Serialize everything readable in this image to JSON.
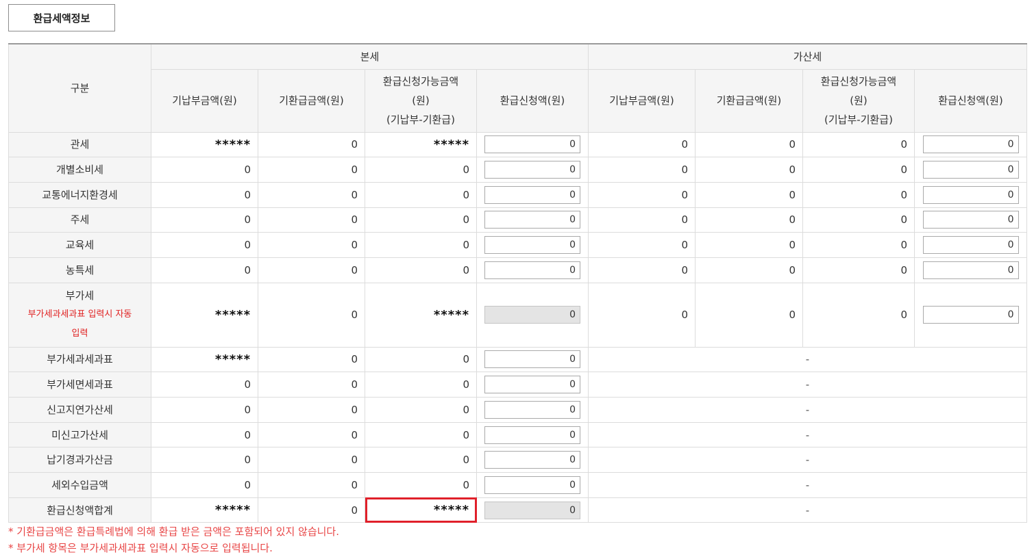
{
  "tab_label": "환급세액정보",
  "headers": {
    "gubun": "구분",
    "bonse": "본세",
    "gasanse": "가산세",
    "cols_bonse": [
      "기납부금액(원)",
      "기환급금액(원)",
      "환급신청가능금액\n(원)\n(기납부-기환급)",
      "환급신청액(원)"
    ],
    "cols_gasanse": [
      "기납부금액(원)",
      "기환급금액(원)",
      "환급신청가능금액\n(원)\n(기납부-기환급)",
      "환급신청액(원)"
    ]
  },
  "rows": [
    {
      "label": "관세",
      "b1": "*****",
      "b2": "0",
      "b3": "*****",
      "b4": "0",
      "g1": "0",
      "g2": "0",
      "g3": "0",
      "g4": "0"
    },
    {
      "label": "개별소비세",
      "b1": "0",
      "b2": "0",
      "b3": "0",
      "b4": "0",
      "g1": "0",
      "g2": "0",
      "g3": "0",
      "g4": "0"
    },
    {
      "label": "교통에너지환경세",
      "b1": "0",
      "b2": "0",
      "b3": "0",
      "b4": "0",
      "g1": "0",
      "g2": "0",
      "g3": "0",
      "g4": "0"
    },
    {
      "label": "주세",
      "b1": "0",
      "b2": "0",
      "b3": "0",
      "b4": "0",
      "g1": "0",
      "g2": "0",
      "g3": "0",
      "g4": "0"
    },
    {
      "label": "교육세",
      "b1": "0",
      "b2": "0",
      "b3": "0",
      "b4": "0",
      "g1": "0",
      "g2": "0",
      "g3": "0",
      "g4": "0"
    },
    {
      "label": "농특세",
      "b1": "0",
      "b2": "0",
      "b3": "0",
      "b4": "0",
      "g1": "0",
      "g2": "0",
      "g3": "0",
      "g4": "0"
    },
    {
      "label": "부가세",
      "note": "부가세과세과표 입력시 자동\n입력",
      "b1": "*****",
      "b2": "0",
      "b3": "*****",
      "b4": "0",
      "b4_readonly": true,
      "g1": "0",
      "g2": "0",
      "g3": "0",
      "g4": "0"
    },
    {
      "label": "부가세과세과표",
      "b1": "*****",
      "b2": "0",
      "b3": "0",
      "b4": "0",
      "gdash": "-"
    },
    {
      "label": "부가세면세과표",
      "b1": "0",
      "b2": "0",
      "b3": "0",
      "b4": "0",
      "gdash": "-"
    },
    {
      "label": "신고지연가산세",
      "b1": "0",
      "b2": "0",
      "b3": "0",
      "b4": "0",
      "gdash": "-"
    },
    {
      "label": "미신고가산세",
      "b1": "0",
      "b2": "0",
      "b3": "0",
      "b4": "0",
      "gdash": "-"
    },
    {
      "label": "납기경과가산금",
      "b1": "0",
      "b2": "0",
      "b3": "0",
      "b4": "0",
      "gdash": "-"
    },
    {
      "label": "세외수입금액",
      "b1": "0",
      "b2": "0",
      "b3": "0",
      "b4": "0",
      "gdash": "-"
    },
    {
      "label": "환급신청액합계",
      "b1": "*****",
      "b2": "0",
      "b3": "*****",
      "b4": "0",
      "b4_readonly": true,
      "b3_highlight": true,
      "gdash": "-"
    }
  ],
  "notes": [
    "* 기환급금액은 환급특례법에 의해 환급 받은 금액은 포함되어 있지 않습니다.",
    "* 부가세 항목은 부가세과세과표 입력시 자동으로 입력됩니다."
  ]
}
